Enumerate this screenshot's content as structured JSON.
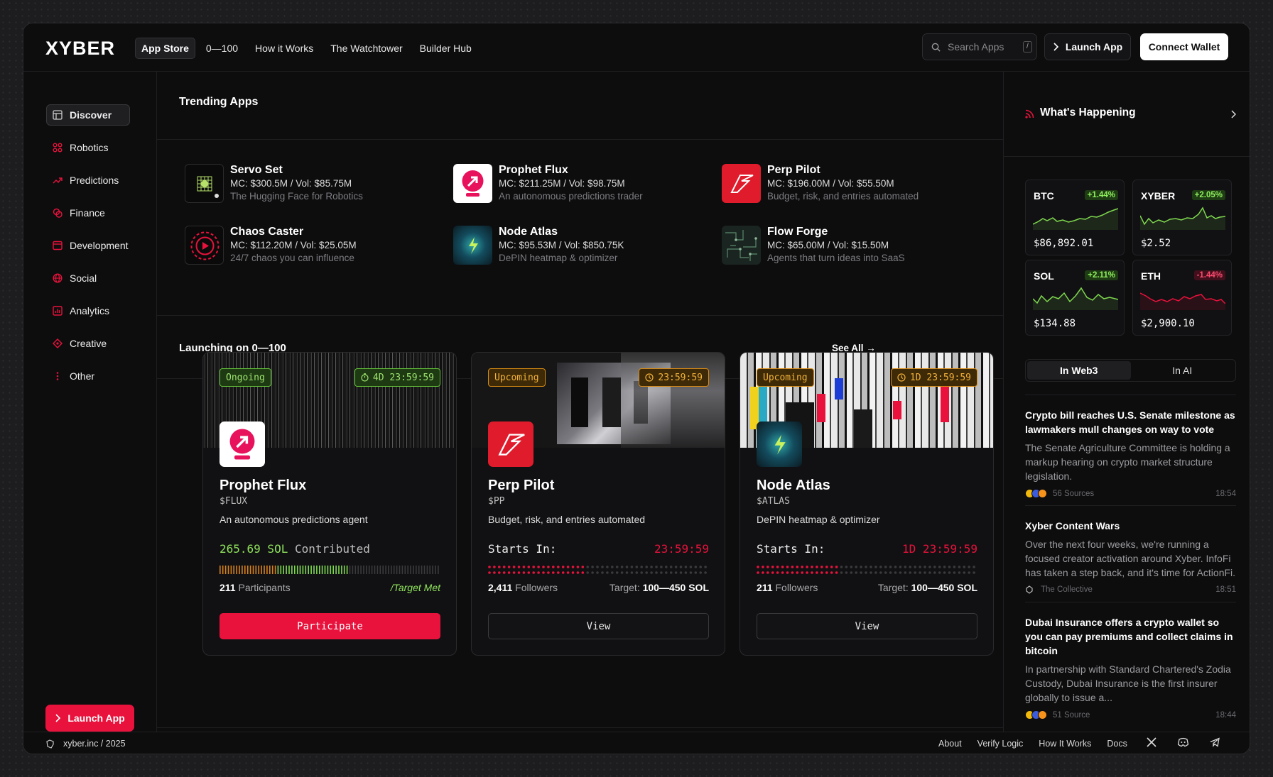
{
  "header": {
    "logo": "XYBER",
    "nav": [
      "App Store",
      "0—100",
      "How it Works",
      "The Watchtower",
      "Builder Hub"
    ],
    "search_placeholder": "Search Apps",
    "search_shortcut": "/",
    "launch_label": "Launch App",
    "connect_label": "Connect Wallet"
  },
  "sidebar": {
    "items": [
      {
        "label": "Discover",
        "icon": "layout-icon"
      },
      {
        "label": "Robotics",
        "icon": "robot-icon"
      },
      {
        "label": "Predictions",
        "icon": "trend-icon"
      },
      {
        "label": "Finance",
        "icon": "coins-icon"
      },
      {
        "label": "Development",
        "icon": "code-icon"
      },
      {
        "label": "Social",
        "icon": "globe-icon"
      },
      {
        "label": "Analytics",
        "icon": "chart-icon"
      },
      {
        "label": "Creative",
        "icon": "palette-icon"
      },
      {
        "label": "Other",
        "icon": "more-icon"
      }
    ],
    "launch_label": "Launch App"
  },
  "trending": {
    "title": "Trending Apps",
    "apps": [
      {
        "name": "Servo Set",
        "stats": "MC: $300.5M / Vol: $85.75M",
        "desc": "The Hugging Face for Robotics"
      },
      {
        "name": "Prophet Flux",
        "stats": "MC: $211.25M / Vol: $98.75M",
        "desc": "An autonomous predictions trader"
      },
      {
        "name": "Perp Pilot",
        "stats": "MC: $196.00M / Vol: $55.50M",
        "desc": "Budget, risk, and entries automated"
      },
      {
        "name": "Chaos Caster",
        "stats": "MC: $112.20M / Vol: $25.05M",
        "desc": "24/7 chaos you can influence"
      },
      {
        "name": "Node Atlas",
        "stats": "MC: $95.53M / Vol: $850.75K",
        "desc": "DePIN heatmap & optimizer"
      },
      {
        "name": "Flow Forge",
        "stats": "MC: $65.00M / Vol: $15.50M",
        "desc": "Agents that turn ideas into SaaS"
      }
    ]
  },
  "launching": {
    "title": "Launching on 0—100",
    "see_all": "See All →",
    "cards": [
      {
        "status": "Ongoing",
        "timer": "4D 23:59:59",
        "name": "Prophet Flux",
        "ticker": "$FLUX",
        "desc": "An autonomous predictions agent",
        "left_text": "265.69 SOL",
        "left_sub": "Contributed",
        "right_text": "",
        "count": "211",
        "count_label": "Participants",
        "target_label": "",
        "target_value": "",
        "target_met": "/Target Met",
        "cta": "Participate",
        "progress": 0.58
      },
      {
        "status": "Upcoming",
        "timer": "23:59:59",
        "name": "Perp Pilot",
        "ticker": "$PP",
        "desc": "Budget, risk, and entries automated",
        "left_text": "Starts In:",
        "left_sub": "",
        "right_text": "23:59:59",
        "count": "2,411",
        "count_label": "Followers",
        "target_label": "Target:",
        "target_value": "100—450 SOL",
        "target_met": "",
        "cta": "View",
        "progress": 0.42
      },
      {
        "status": "Upcoming",
        "timer": "1D 23:59:59",
        "name": "Node Atlas",
        "ticker": "$ATLAS",
        "desc": "DePIN heatmap & optimizer",
        "left_text": "Starts In:",
        "left_sub": "",
        "right_text": "1D 23:59:59",
        "count": "211",
        "count_label": "Followers",
        "target_label": "Target:",
        "target_value": "100—450 SOL",
        "target_met": "",
        "cta": "View",
        "progress": 0.36
      }
    ]
  },
  "happening": {
    "title": "What's Happening",
    "tickers": [
      {
        "symbol": "BTC",
        "change": "+1.44%",
        "price": "$86,892.01",
        "direction": "up",
        "color": "#7fd94f"
      },
      {
        "symbol": "XYBER",
        "change": "+2.05%",
        "price": "$2.52",
        "direction": "up",
        "color": "#7fd94f"
      },
      {
        "symbol": "SOL",
        "change": "+2.11%",
        "price": "$134.88",
        "direction": "up",
        "color": "#7fd94f"
      },
      {
        "symbol": "ETH",
        "change": "-1.44%",
        "price": "$2,900.10",
        "direction": "down",
        "color": "#e8123c"
      }
    ],
    "tabs": [
      "In Web3",
      "In AI"
    ],
    "news": [
      {
        "headline": "Crypto bill reaches U.S. Senate milestone as lawmakers mull changes on way to vote",
        "body": "The Senate Agriculture Committee is holding a markup hearing on crypto market structure legislation.",
        "sources": "56 Sources",
        "time": "18:54"
      },
      {
        "headline": "Xyber Content Wars",
        "body": "Over the next four weeks, we're running a focused creator activation around Xyber. InfoFi has taken a step back, and it's time for ActionFi.",
        "sources": "The Collective",
        "time": "18:51"
      },
      {
        "headline": "Dubai Insurance offers a crypto wallet so you can pay premiums and collect claims in bitcoin",
        "body": "In partnership with Standard Chartered's Zodia Custody, Dubai Insurance is the first insurer globally to issue a...",
        "sources": "51 Source",
        "time": "18:44"
      }
    ]
  },
  "footer": {
    "copyright": "xyber.inc / 2025",
    "links": [
      "About",
      "Verify Logic",
      "How It Works",
      "Docs"
    ]
  },
  "colors": {
    "accent": "#e8123c",
    "green": "#7fd94f",
    "amber": "#f3b23a"
  }
}
